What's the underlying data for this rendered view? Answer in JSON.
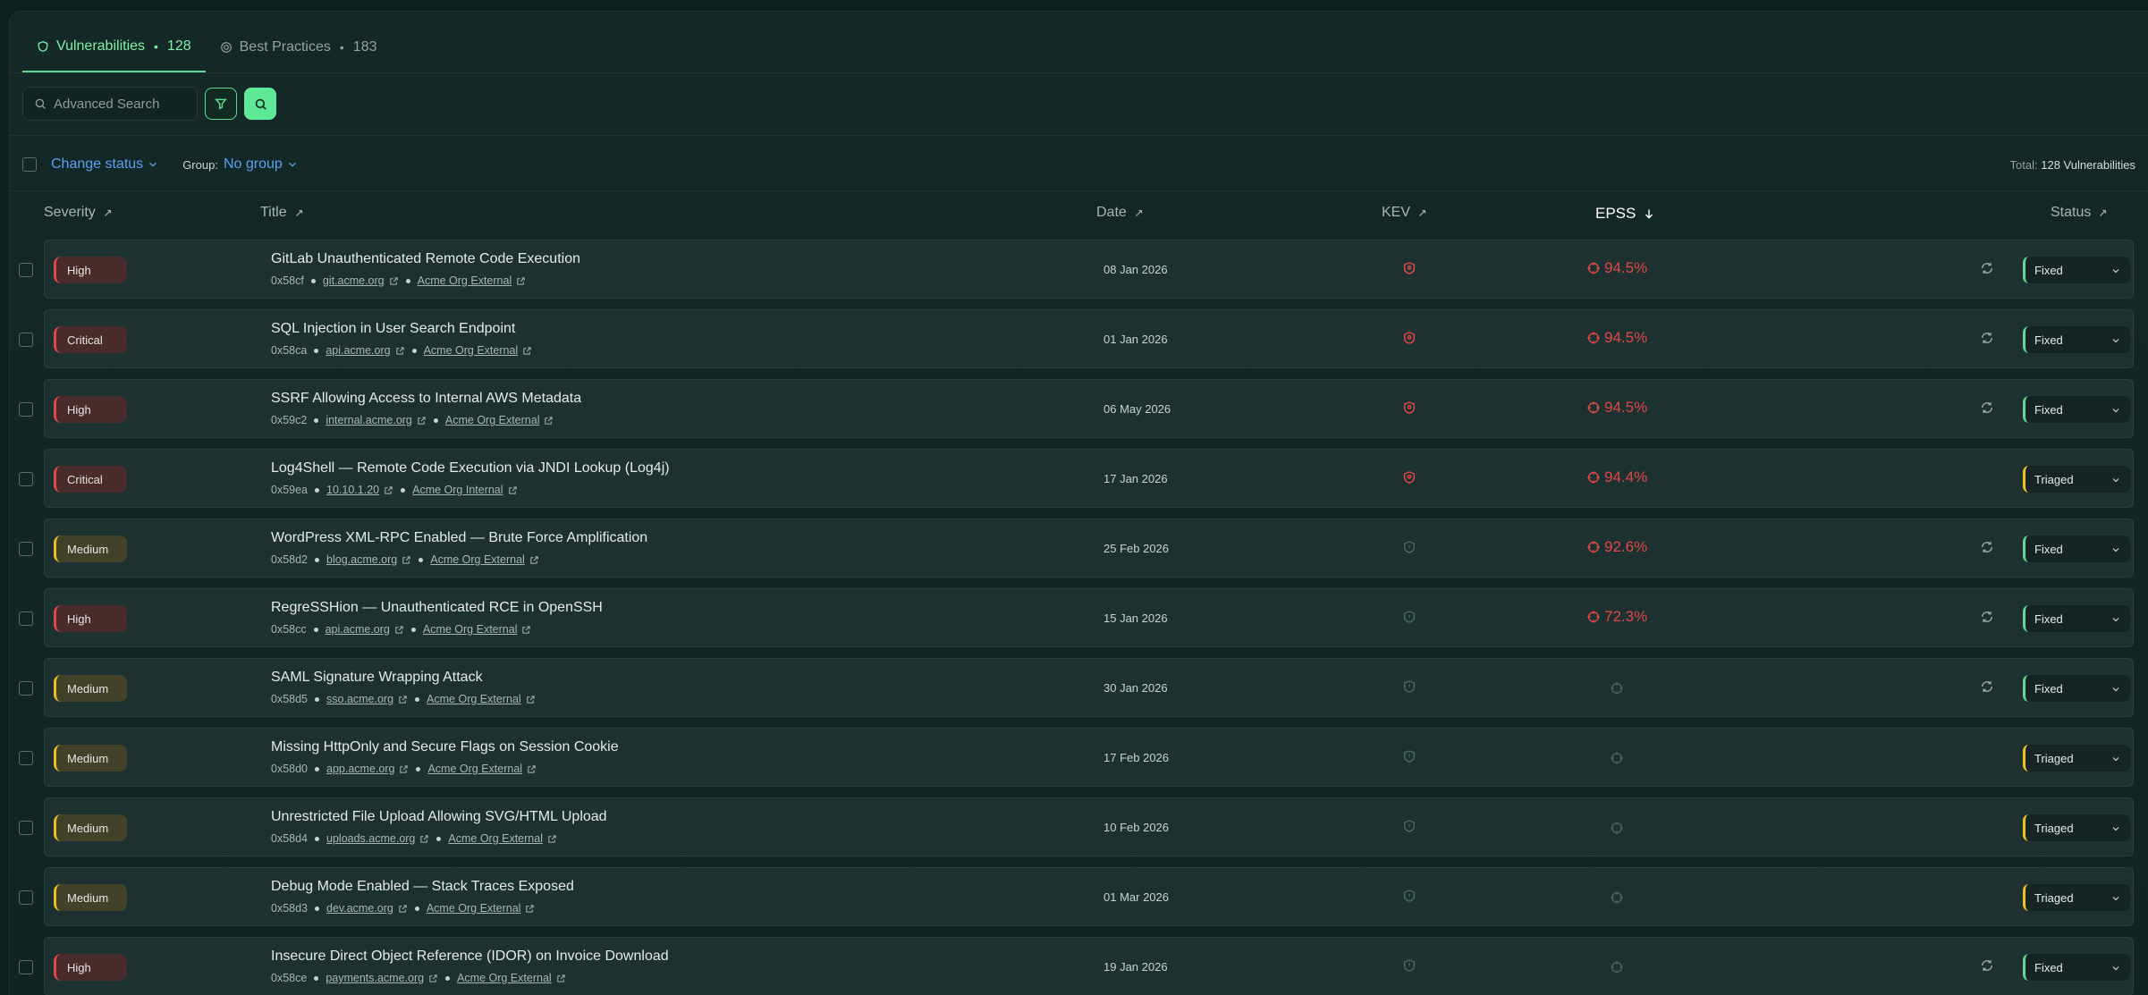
{
  "tabs": [
    {
      "label": "Vulnerabilities",
      "count": "128"
    },
    {
      "label": "Best Practices",
      "count": "183"
    }
  ],
  "search": {
    "placeholder": "Advanced Search"
  },
  "toolbar": {
    "change_status": "Change status",
    "group_label": "Group:",
    "group_value": "No group",
    "total_label": "Total:",
    "total_value": "128 Vulnerabilities"
  },
  "columns": {
    "severity": "Severity",
    "title": "Title",
    "date": "Date",
    "kev": "KEV",
    "epss": "EPSS",
    "status": "Status"
  },
  "colors": {
    "accent": "#5fdb8f",
    "link": "#5aa0f0",
    "critical": "#e24848",
    "medium": "#f0c020"
  },
  "rows": [
    {
      "severity": "High",
      "sev": "high",
      "title": "GitLab Unauthenticated Remote Code Execution",
      "id": "0x58cf",
      "host": "git.acme.org",
      "org": "Acme Org External",
      "date": "08 Jan 2026",
      "kev": true,
      "epss": "94.5%",
      "sync": true,
      "status": "Fixed"
    },
    {
      "severity": "Critical",
      "sev": "critical",
      "title": "SQL Injection in User Search Endpoint",
      "id": "0x58ca",
      "host": "api.acme.org",
      "org": "Acme Org External",
      "date": "01 Jan 2026",
      "kev": true,
      "epss": "94.5%",
      "sync": true,
      "status": "Fixed"
    },
    {
      "severity": "High",
      "sev": "high",
      "title": "SSRF Allowing Access to Internal AWS Metadata",
      "id": "0x59c2",
      "host": "internal.acme.org",
      "org": "Acme Org External",
      "date": "06 May 2026",
      "kev": true,
      "epss": "94.5%",
      "sync": true,
      "status": "Fixed"
    },
    {
      "severity": "Critical",
      "sev": "critical",
      "title": "Log4Shell — Remote Code Execution via JNDI Lookup (Log4j)",
      "id": "0x59ea",
      "host": "10.10.1.20",
      "org": "Acme Org Internal",
      "date": "17 Jan 2026",
      "kev": true,
      "epss": "94.4%",
      "sync": false,
      "status": "Triaged"
    },
    {
      "severity": "Medium",
      "sev": "medium",
      "title": "WordPress XML-RPC Enabled — Brute Force Amplification",
      "id": "0x58d2",
      "host": "blog.acme.org",
      "org": "Acme Org External",
      "date": "25 Feb 2026",
      "kev": false,
      "epss": "92.6%",
      "sync": true,
      "status": "Fixed"
    },
    {
      "severity": "High",
      "sev": "high",
      "title": "RegreSSHion — Unauthenticated RCE in OpenSSH",
      "id": "0x58cc",
      "host": "api.acme.org",
      "org": "Acme Org External",
      "date": "15 Jan 2026",
      "kev": false,
      "epss": "72.3%",
      "sync": true,
      "status": "Fixed"
    },
    {
      "severity": "Medium",
      "sev": "medium",
      "title": "SAML Signature Wrapping Attack",
      "id": "0x58d5",
      "host": "sso.acme.org",
      "org": "Acme Org External",
      "date": "30 Jan 2026",
      "kev": false,
      "epss": "",
      "sync": true,
      "status": "Fixed"
    },
    {
      "severity": "Medium",
      "sev": "medium",
      "title": "Missing HttpOnly and Secure Flags on Session Cookie",
      "id": "0x58d0",
      "host": "app.acme.org",
      "org": "Acme Org External",
      "date": "17 Feb 2026",
      "kev": false,
      "epss": "",
      "sync": false,
      "status": "Triaged"
    },
    {
      "severity": "Medium",
      "sev": "medium",
      "title": "Unrestricted File Upload Allowing SVG/HTML Upload",
      "id": "0x58d4",
      "host": "uploads.acme.org",
      "org": "Acme Org External",
      "date": "10 Feb 2026",
      "kev": false,
      "epss": "",
      "sync": false,
      "status": "Triaged"
    },
    {
      "severity": "Medium",
      "sev": "medium",
      "title": "Debug Mode Enabled — Stack Traces Exposed",
      "id": "0x58d3",
      "host": "dev.acme.org",
      "org": "Acme Org External",
      "date": "01 Mar 2026",
      "kev": false,
      "epss": "",
      "sync": false,
      "status": "Triaged"
    },
    {
      "severity": "High",
      "sev": "high",
      "title": "Insecure Direct Object Reference (IDOR) on Invoice Download",
      "id": "0x58ce",
      "host": "payments.acme.org",
      "org": "Acme Org External",
      "date": "19 Jan 2026",
      "kev": false,
      "epss": "",
      "sync": true,
      "status": "Fixed"
    }
  ]
}
